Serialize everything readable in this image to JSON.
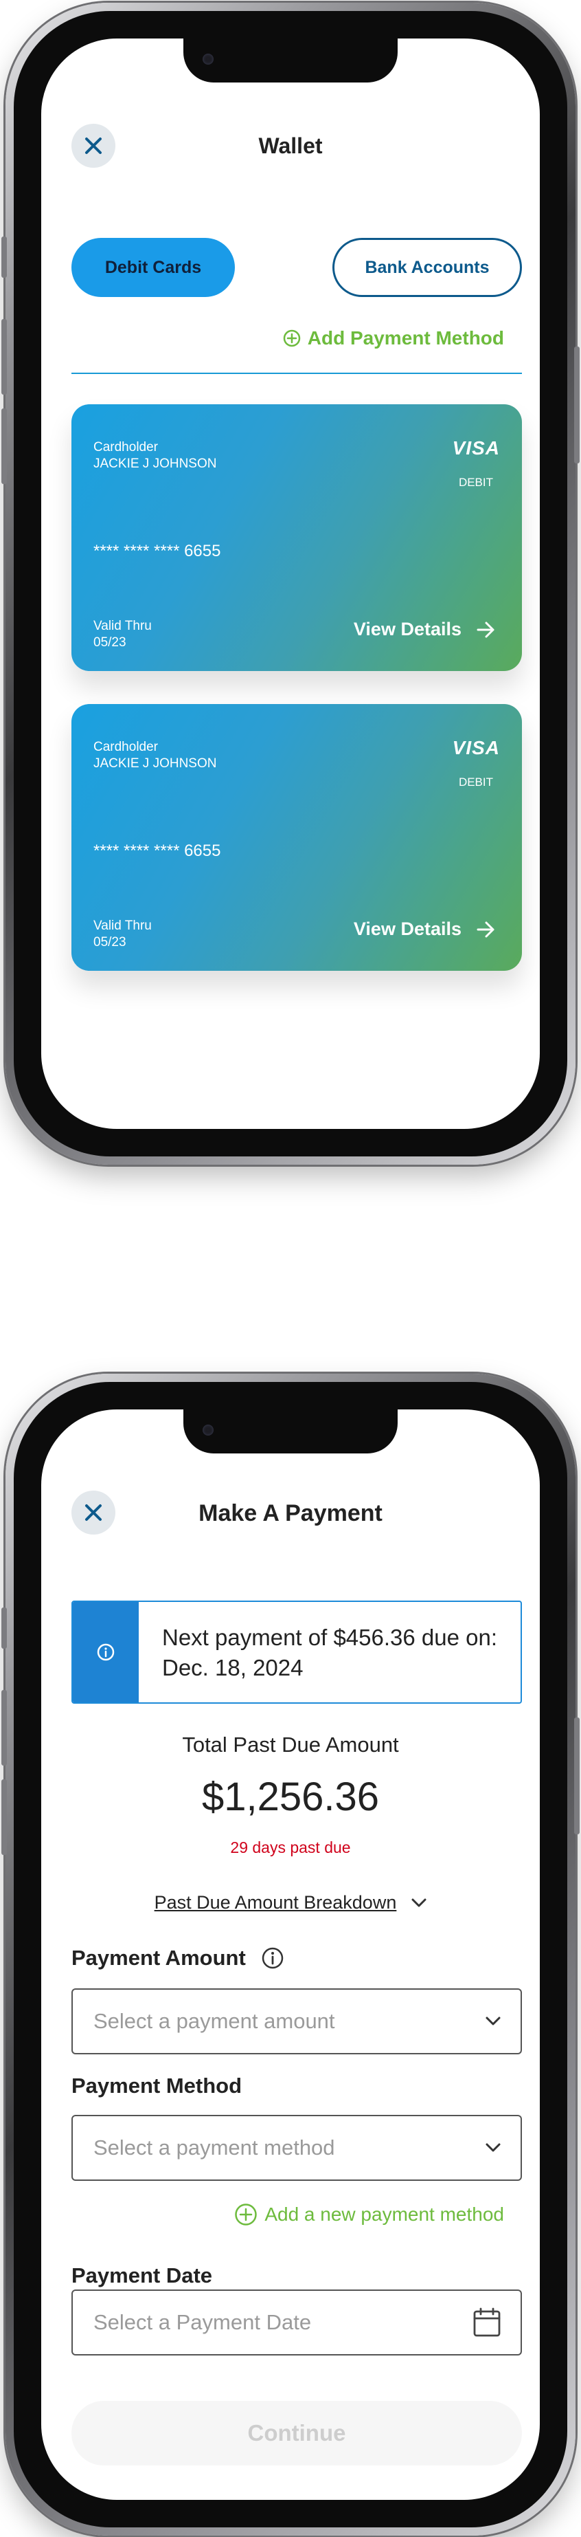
{
  "wallet": {
    "title": "Wallet",
    "tabs": {
      "debit": "Debit Cards",
      "bank": "Bank Accounts"
    },
    "add_payment_label": "Add Payment Method",
    "cards": [
      {
        "cardholder_label": "Cardholder",
        "cardholder_name": "JACKIE J JOHNSON",
        "brand": "VISA",
        "card_type": "DEBIT",
        "masked_number": "**** **** **** 6655",
        "valid_label": "Valid Thru",
        "valid_value": "05/23",
        "details_label": "View Details"
      },
      {
        "cardholder_label": "Cardholder",
        "cardholder_name": "JACKIE J JOHNSON",
        "brand": "VISA",
        "card_type": "DEBIT",
        "masked_number": "**** **** **** 6655",
        "valid_label": "Valid Thru",
        "valid_value": "05/23",
        "details_label": "View Details"
      }
    ]
  },
  "payment": {
    "title": "Make A Payment",
    "info_line1": "Next payment of $456.36 due on:",
    "info_line2": "Dec. 18, 2024",
    "total_label": "Total Past Due Amount",
    "total_amount": "$1,256.36",
    "past_due_note": "29 days past due",
    "breakdown_label": "Past Due Amount Breakdown",
    "amount_label": "Payment Amount",
    "amount_placeholder": "Select a payment amount",
    "method_label": "Payment Method",
    "method_placeholder": "Select a payment method",
    "add_method_label": "Add a new payment method",
    "date_label": "Payment Date",
    "date_placeholder": "Select a Payment Date",
    "continue_label": "Continue"
  },
  "colors": {
    "primary_blue": "#1a9be8",
    "dark_blue": "#0d5a8c",
    "accent_green": "#6dbb3d",
    "error_red": "#d0021b",
    "info_blue": "#1e83d3"
  },
  "icons": {
    "close": "close-icon",
    "add": "plus-circle-icon",
    "arrow": "arrow-right-icon",
    "info": "info-icon",
    "chevron": "chevron-down-icon",
    "calendar": "calendar-icon"
  }
}
